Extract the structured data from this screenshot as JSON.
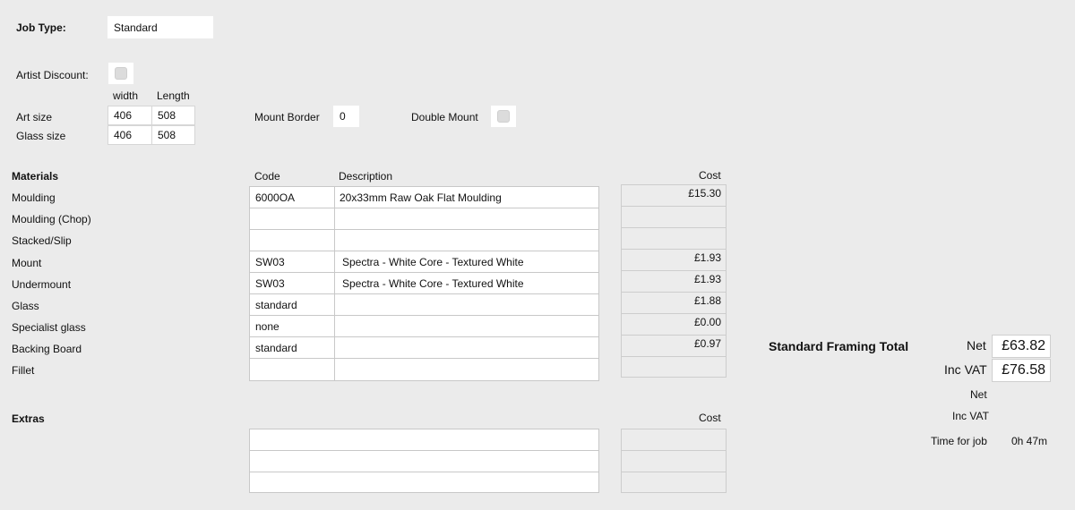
{
  "job": {
    "type_label": "Job Type:",
    "type_value": "Standard",
    "artist_discount_label": "Artist Discount:",
    "artist_discount_checked": false
  },
  "size": {
    "width_header": "width",
    "length_header": "Length",
    "art_label": "Art size",
    "art_width": "406",
    "art_length": "508",
    "glass_label": "Glass size",
    "glass_width": "406",
    "glass_length": "508",
    "mount_border_label": "Mount Border",
    "mount_border_value": "0",
    "double_mount_label": "Double Mount",
    "double_mount_checked": false
  },
  "materials": {
    "heading": "Materials",
    "code_header": "Code",
    "description_header": "Description",
    "cost_header": "Cost",
    "rows": [
      {
        "label": "Moulding",
        "code": "6000OA",
        "description": "20x33mm Raw Oak Flat Moulding",
        "cost": "£15.30"
      },
      {
        "label": "Moulding (Chop)",
        "code": "",
        "description": "",
        "cost": ""
      },
      {
        "label": "Stacked/Slip",
        "code": "",
        "description": "",
        "cost": ""
      },
      {
        "label": "Mount",
        "code": "SW03",
        "description": "Spectra - White Core - Textured White",
        "cost": "£1.93"
      },
      {
        "label": "Undermount",
        "code": "SW03",
        "description": "Spectra - White Core - Textured White",
        "cost": "£1.93"
      },
      {
        "label": "Glass",
        "code": "standard",
        "description": "",
        "cost": "£1.88"
      },
      {
        "label": "Specialist glass",
        "code": "none",
        "description": "",
        "cost": "£0.00"
      },
      {
        "label": "Backing Board",
        "code": "standard",
        "description": "",
        "cost": "£0.97"
      },
      {
        "label": "Fillet",
        "code": "",
        "description": "",
        "cost": ""
      }
    ]
  },
  "extras": {
    "heading": "Extras",
    "cost_header": "Cost",
    "rows": [
      {
        "value": "",
        "cost": ""
      },
      {
        "value": "",
        "cost": ""
      },
      {
        "value": "",
        "cost": ""
      }
    ]
  },
  "totals": {
    "heading": "Standard Framing Total",
    "net_label": "Net",
    "net_value": "£63.82",
    "inc_vat_label": "Inc VAT",
    "inc_vat_value": "£76.58",
    "net_label_2": "Net",
    "inc_vat_label_2": "Inc VAT",
    "time_label": "Time for job",
    "time_value": "0h 47m"
  }
}
